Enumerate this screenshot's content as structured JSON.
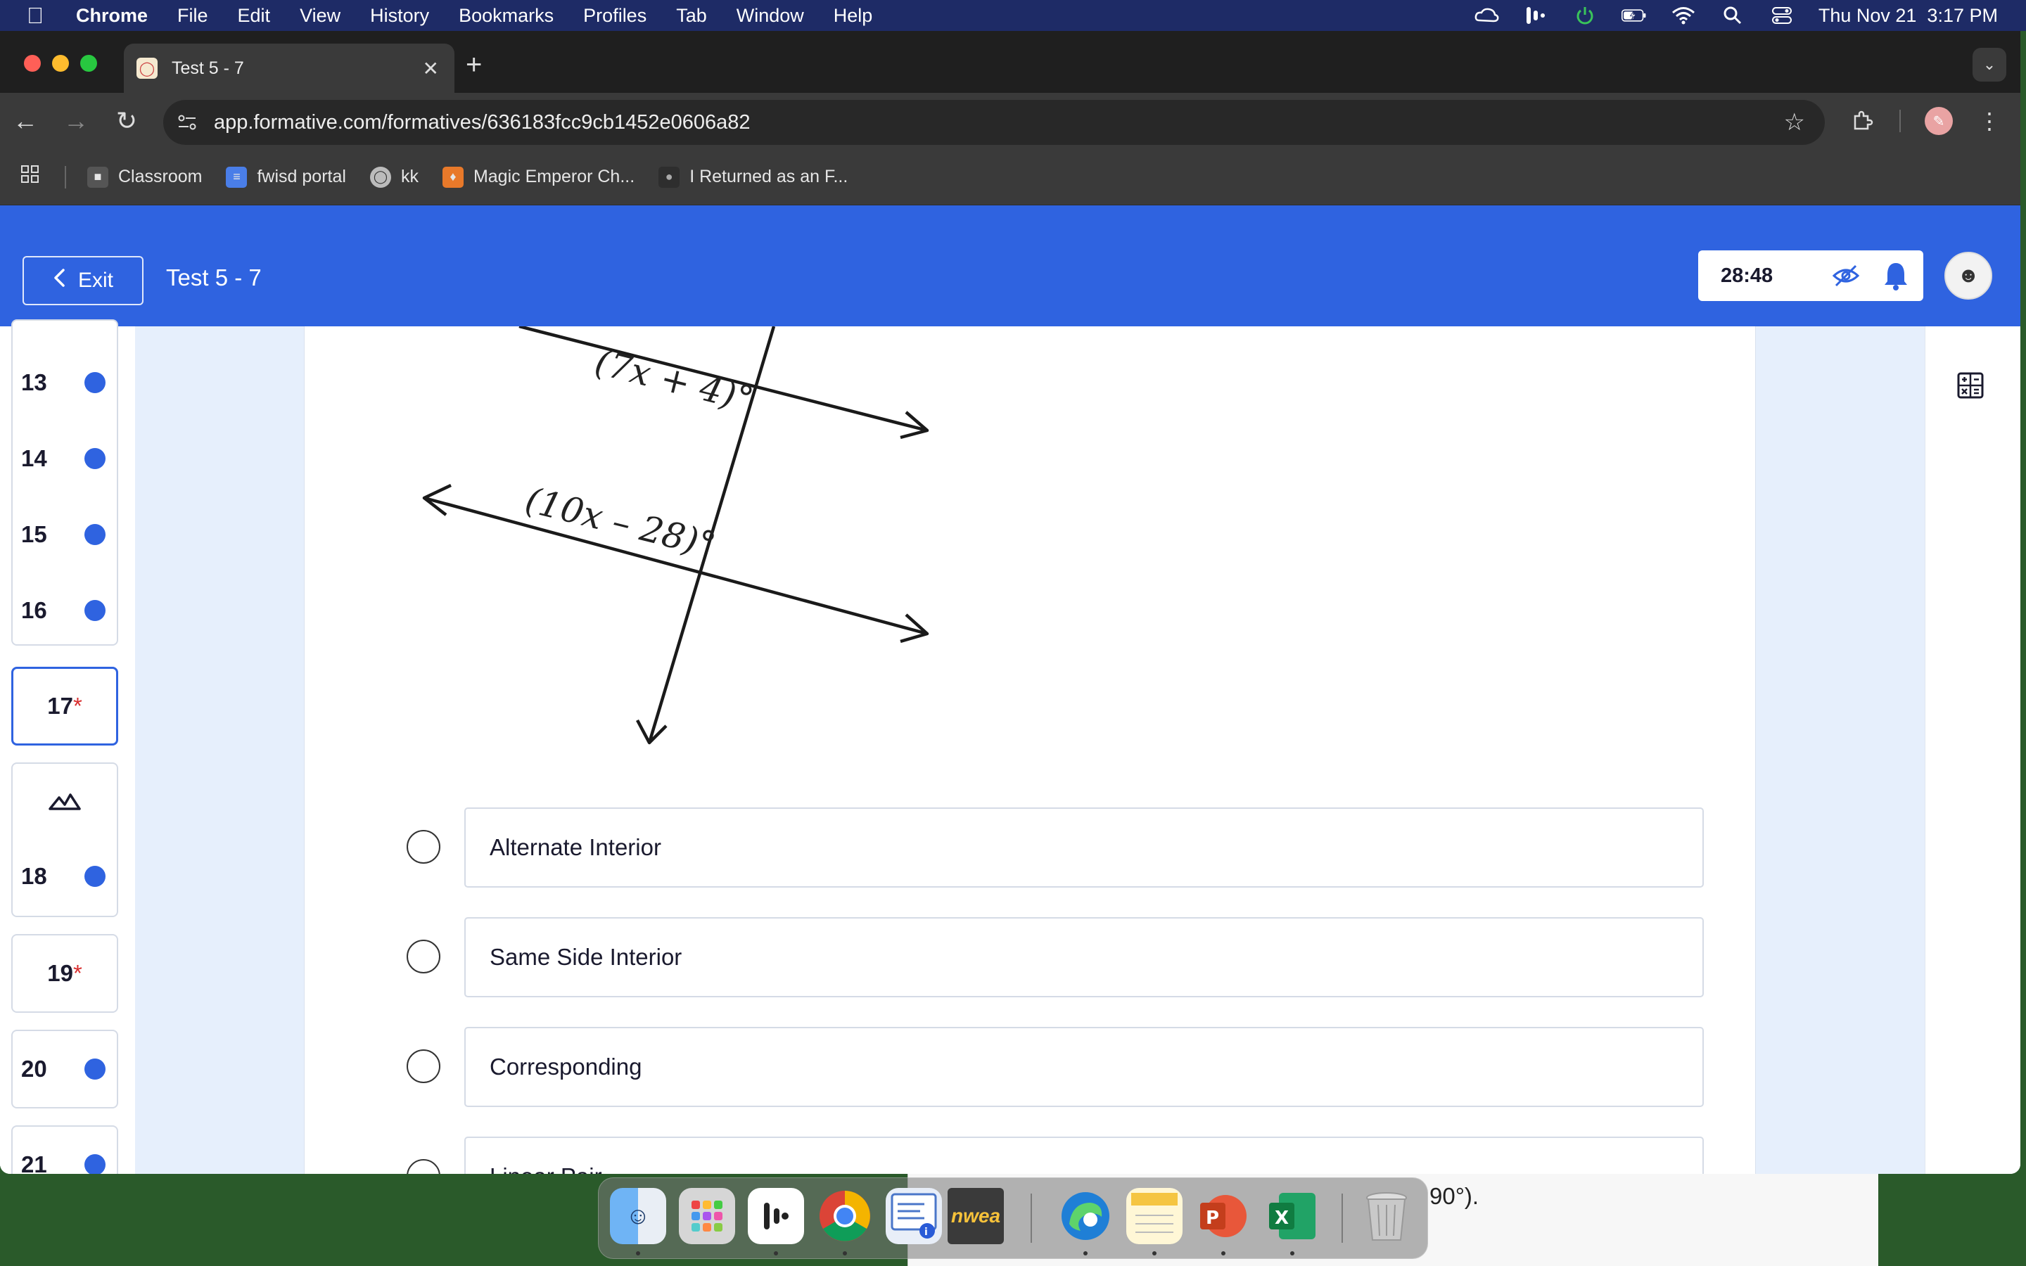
{
  "menubar": {
    "apple": "",
    "app": "Chrome",
    "items": [
      "File",
      "Edit",
      "View",
      "History",
      "Bookmarks",
      "Profiles",
      "Tab",
      "Window",
      "Help"
    ],
    "datetime": "Thu Nov 21  3:17 PM"
  },
  "browser": {
    "tab_title": "Test 5 - 7",
    "url": "app.formative.com/formatives/636183fcc9cb1452e0606a82",
    "bookmarks": [
      {
        "label": "Classroom",
        "icon": "classroom-icon"
      },
      {
        "label": "fwisd portal",
        "icon": "docs-icon"
      },
      {
        "label": "kk",
        "icon": "globe-icon"
      },
      {
        "label": "Magic Emperor Ch...",
        "icon": "manga-icon"
      },
      {
        "label": "I Returned as an F...",
        "icon": "avatar-icon"
      }
    ]
  },
  "app": {
    "exit_label": "Exit",
    "title": "Test 5 - 7",
    "timer": "28:48",
    "accent": "#2f63e0"
  },
  "questions": {
    "q13": "13",
    "q14": "14",
    "q15": "15",
    "q16": "16",
    "q17": "17",
    "q17_mark": "*",
    "q18": "18",
    "q19": "19",
    "q19_mark": "*",
    "q20": "20",
    "q21": "21"
  },
  "figure": {
    "angle_top": "(7x + 4)°",
    "angle_bottom": "(10x – 28)°"
  },
  "choices": [
    "Alternate Interior",
    "Same Side Interior",
    "Corresponding",
    "Linear Pair"
  ],
  "background_window_text": "90°).",
  "dock": {
    "nwea_label": "nwea"
  }
}
